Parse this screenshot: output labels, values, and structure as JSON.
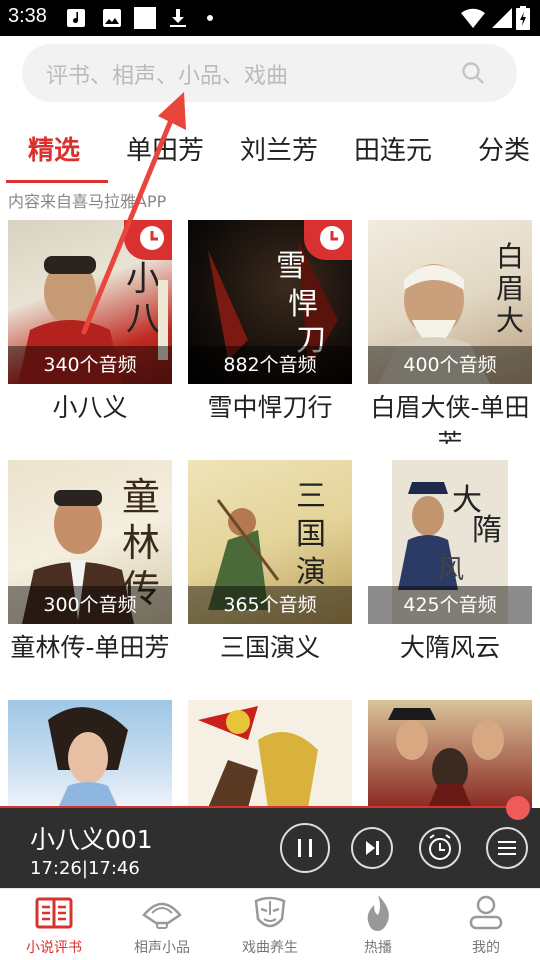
{
  "status_bar": {
    "time": "3:38"
  },
  "search": {
    "placeholder": "评书、相声、小品、戏曲"
  },
  "tabs": [
    {
      "label": "精选",
      "active": true
    },
    {
      "label": "单田芳"
    },
    {
      "label": "刘兰芳"
    },
    {
      "label": "田连元"
    },
    {
      "label": "分类"
    }
  ],
  "source_note": "内容来自喜马拉雅APP",
  "cards": [
    {
      "title": "小八义",
      "count": "340个音频",
      "badge": "clock-icon",
      "art_text": "小八义"
    },
    {
      "title": "雪中悍刀行",
      "count": "882个音频",
      "badge": "clock-icon",
      "art_text": "雪中悍刀行"
    },
    {
      "title": "白眉大侠-单田芳",
      "count": "400个音频",
      "art_text": "白眉大侠"
    },
    {
      "title": "童林传-单田芳",
      "count": "300个音频",
      "art_text": "童林传"
    },
    {
      "title": "三国演义",
      "count": "365个音频",
      "art_text": "三国演义"
    },
    {
      "title": "大隋风云",
      "count": "425个音频",
      "art_text": "大隋风云"
    },
    {
      "title": "",
      "count": ""
    },
    {
      "title": "",
      "count": ""
    },
    {
      "title": "",
      "count": ""
    }
  ],
  "player": {
    "title": "小八义001",
    "time": "17:26|17:46",
    "progress": 0.96,
    "buttons": [
      "pause-icon",
      "next-icon",
      "timer-icon",
      "playlist-icon"
    ]
  },
  "bottom_nav": [
    {
      "label": "小说评书",
      "icon": "book-icon",
      "active": true
    },
    {
      "label": "相声小品",
      "icon": "fan-icon"
    },
    {
      "label": "戏曲养生",
      "icon": "opera-mask-icon"
    },
    {
      "label": "热播",
      "icon": "flame-icon"
    },
    {
      "label": "我的",
      "icon": "user-icon"
    }
  ],
  "colors": {
    "accent": "#d9312f",
    "player_bg": "#2f2f2f"
  }
}
